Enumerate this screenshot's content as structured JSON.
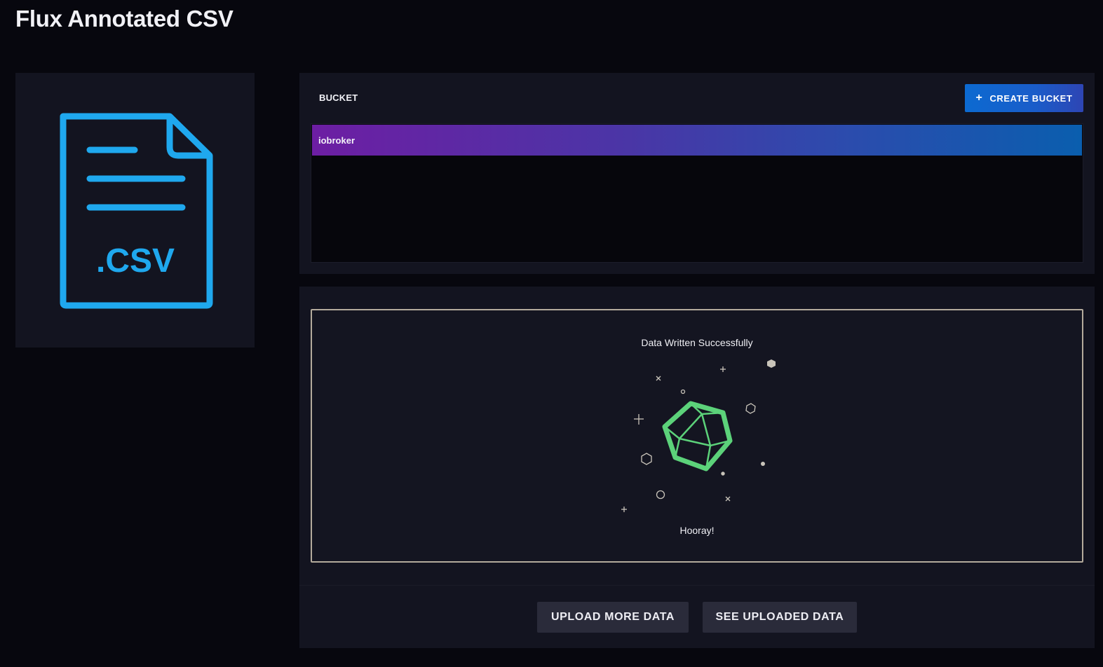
{
  "page": {
    "title": "Flux Annotated CSV"
  },
  "file_card": {
    "icon": "csv-file-icon",
    "icon_text": ".CSV",
    "accent_color": "#1fa8ee"
  },
  "bucket": {
    "label": "BUCKET",
    "create_button": {
      "icon": "plus-icon",
      "plus": "+",
      "label": "CREATE BUCKET"
    },
    "items": [
      {
        "name": "iobroker",
        "selected": true
      }
    ]
  },
  "result": {
    "title": "Data Written Successfully",
    "illustration": "success-gem-icon",
    "gem_color": "#5cd27a",
    "message": "Hooray!"
  },
  "actions": {
    "upload_more": "UPLOAD MORE DATA",
    "see_uploaded": "SEE UPLOADED DATA"
  }
}
